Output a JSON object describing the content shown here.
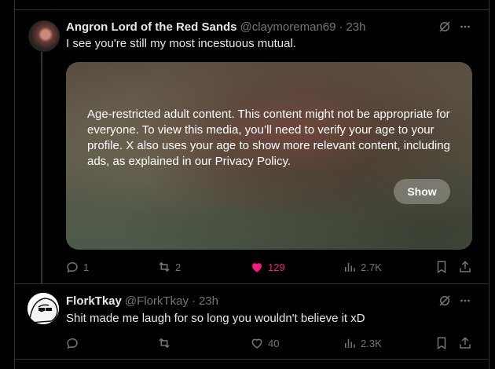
{
  "colors": {
    "background": "#000000",
    "text": "#e7e9ea",
    "muted": "#71767b",
    "like": "#f91880",
    "border": "#2f3336"
  },
  "tweets": [
    {
      "display_name": "Angron Lord of the Red Sands",
      "handle": "@claymoreman69",
      "separator": "·",
      "time": "23h",
      "text": "I see you're still my most incestuous mutual.",
      "media": {
        "notice": "Age-restricted adult content. This content might not be appropriate for everyone. To view this media, you’ll need to verify your age to your profile. X also uses your age to show more relevant content, including ads, as explained in our Privacy Policy.",
        "show_label": "Show"
      },
      "actions": {
        "replies": "1",
        "reposts": "2",
        "likes": "129",
        "views": "2.7K",
        "liked": true
      },
      "icons": [
        "grok-icon",
        "more-icon",
        "reply-icon",
        "repost-icon",
        "like-icon",
        "views-icon",
        "bookmark-icon",
        "share-icon"
      ]
    },
    {
      "display_name": "FlorkTkay",
      "handle": "@FlorkTkay",
      "separator": "·",
      "time": "23h",
      "text": "Shit made me laugh for so long you wouldn't believe it xD",
      "actions": {
        "replies": "",
        "reposts": "",
        "likes": "40",
        "views": "2.3K",
        "liked": false
      },
      "icons": [
        "grok-icon",
        "more-icon",
        "reply-icon",
        "repost-icon",
        "like-icon",
        "views-icon",
        "bookmark-icon",
        "share-icon"
      ]
    }
  ]
}
